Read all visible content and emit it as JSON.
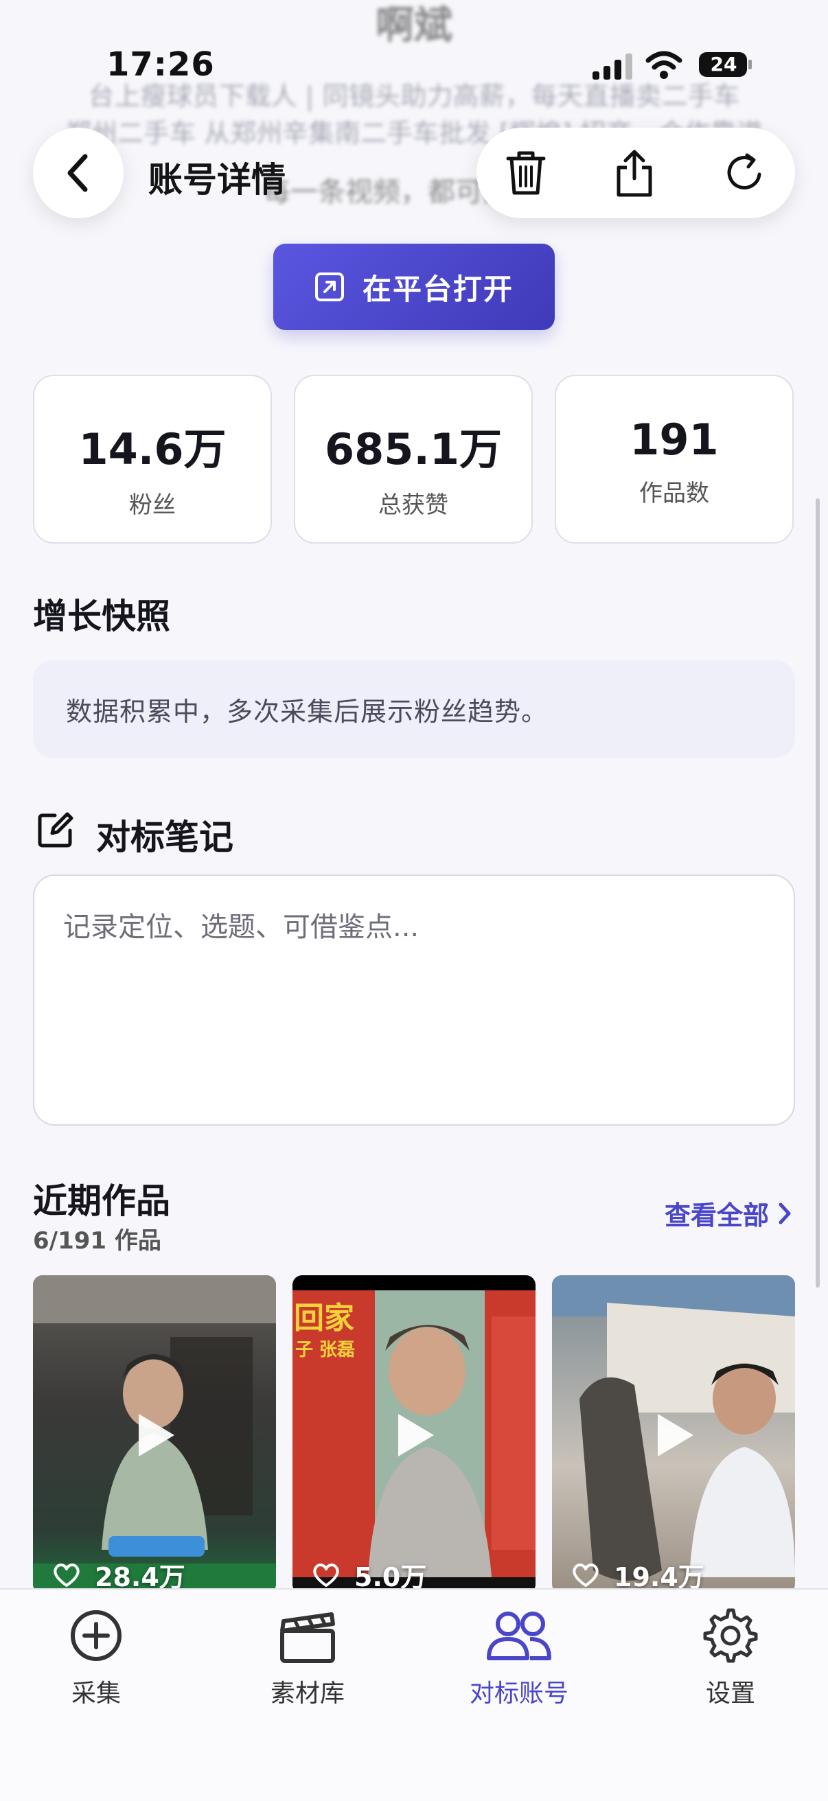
{
  "background_header": {
    "title": "啊斌",
    "line1": "台上瘦球员下载人 | 同镜头助力高薪，每天直播卖二手车",
    "line2": "郑州二手车 从郑州辛集南二手车批发 [辉煌] 招商，合作靠谱",
    "line3": "每一条视频，都可能是一"
  },
  "status_bar": {
    "time": "17:26",
    "battery": "24"
  },
  "nav": {
    "title": "账号详情"
  },
  "open_button": {
    "label": "在平台打开"
  },
  "stats": [
    {
      "value": "14.6万",
      "label": "粉丝"
    },
    {
      "value": "685.1万",
      "label": "总获赞"
    },
    {
      "value": "191",
      "label": "作品数"
    }
  ],
  "growth": {
    "title": "增长快照",
    "message": "数据积累中，多次采集后展示粉丝趋势。"
  },
  "notes": {
    "title": "对标笔记",
    "placeholder": "记录定位、选题、可借鉴点..."
  },
  "works": {
    "title": "近期作品",
    "count_text": "6/191 作品",
    "see_all": "查看全部",
    "items": [
      {
        "likes": "28.4万"
      },
      {
        "likes": "5.0万",
        "poster_text": "回家",
        "poster_sub": "子  张磊"
      },
      {
        "likes": "19.4万"
      }
    ]
  },
  "tabbar": [
    {
      "label": "采集",
      "icon": "plus-circle-icon",
      "active": false
    },
    {
      "label": "素材库",
      "icon": "clapperboard-icon",
      "active": false
    },
    {
      "label": "对标账号",
      "icon": "users-icon",
      "active": true
    },
    {
      "label": "设置",
      "icon": "gear-icon",
      "active": false
    }
  ],
  "colors": {
    "accent": "#4a46c8",
    "background": "#f7f7fb"
  }
}
